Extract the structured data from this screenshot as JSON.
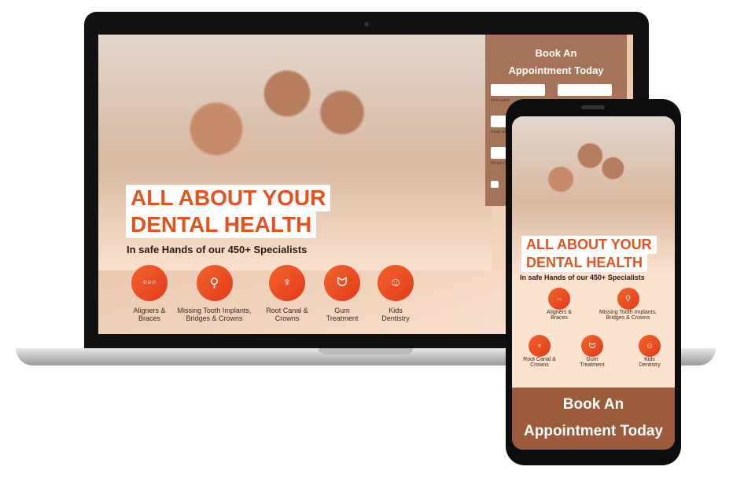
{
  "headline": {
    "line1": "ALL ABOUT YOUR",
    "line2": "DENTAL HEALTH",
    "sub": "In safe Hands of our 450+ Specialists"
  },
  "services": [
    {
      "label1": "Aligners &",
      "label2": "Braces",
      "icon": "braces-icon"
    },
    {
      "label1": "Missing Tooth Implants,",
      "label2": "Bridges & Crowns",
      "icon": "implant-icon"
    },
    {
      "label1": "Root Canal &",
      "label2": "Crowns",
      "icon": "root-canal-icon"
    },
    {
      "label1": "Gum",
      "label2": "Treatment",
      "icon": "gum-icon"
    },
    {
      "label1": "Kids",
      "label2": "Dentistry",
      "icon": "kids-tooth-icon"
    }
  ],
  "form": {
    "title1": "Book An",
    "title2": "Appointment Today",
    "first_name": "First name",
    "email": "Email ad",
    "phone": "Phone n"
  },
  "mobile_cta": {
    "line1": "Book An",
    "line2": "Appointment Today"
  },
  "colors": {
    "accent": "#e4531d",
    "form_bg": "#a57357",
    "cta_bg": "#9c5b3b"
  }
}
